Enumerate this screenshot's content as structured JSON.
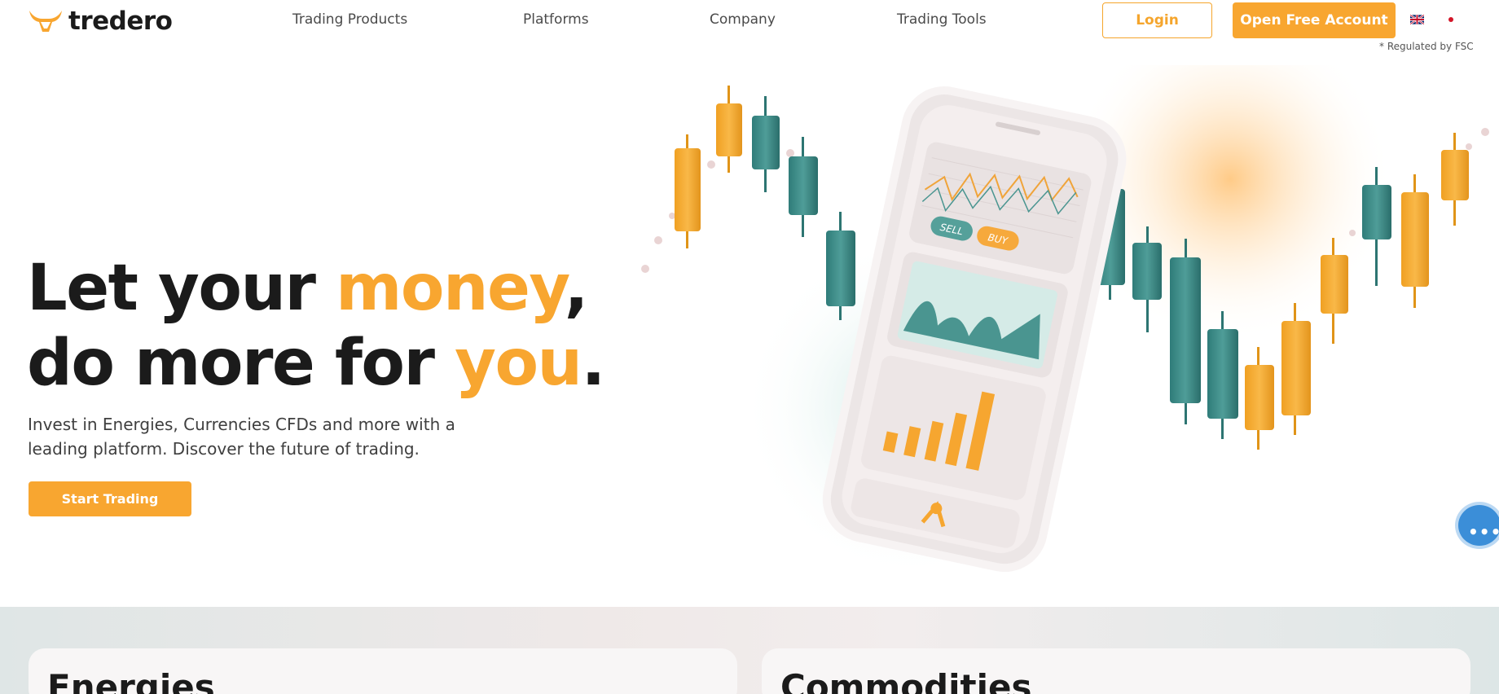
{
  "brand": {
    "name": "tredero",
    "accent_color": "#f8a630",
    "teal_color": "#3c8e8a"
  },
  "nav": {
    "items": [
      {
        "label": "Trading Products"
      },
      {
        "label": "Platforms"
      },
      {
        "label": "Company"
      },
      {
        "label": "Trading Tools"
      }
    ]
  },
  "header": {
    "login_label": "Login",
    "open_account_label": "Open Free Account",
    "regulated_text": "* Regulated by FSC",
    "languages": [
      "English flag",
      "Japanese flag"
    ]
  },
  "hero": {
    "line1_part1": "Let your ",
    "line1_accent": "money",
    "line1_part2": ",",
    "line2_part1": "do more for ",
    "line2_accent": "you",
    "line2_part2": ".",
    "subtitle": "Invest in Energies, Currencies CFDs and more with a leading platform. Discover the future of trading.",
    "cta_label": "Start Trading"
  },
  "phone": {
    "sell_label": "SELL",
    "buy_label": "BUY"
  },
  "sections": {
    "cards": [
      {
        "title": "Energies"
      },
      {
        "title": "Commodities"
      }
    ]
  },
  "icons": {
    "chat": "chat-bubble-icon",
    "logo": "bull-logo-icon"
  }
}
